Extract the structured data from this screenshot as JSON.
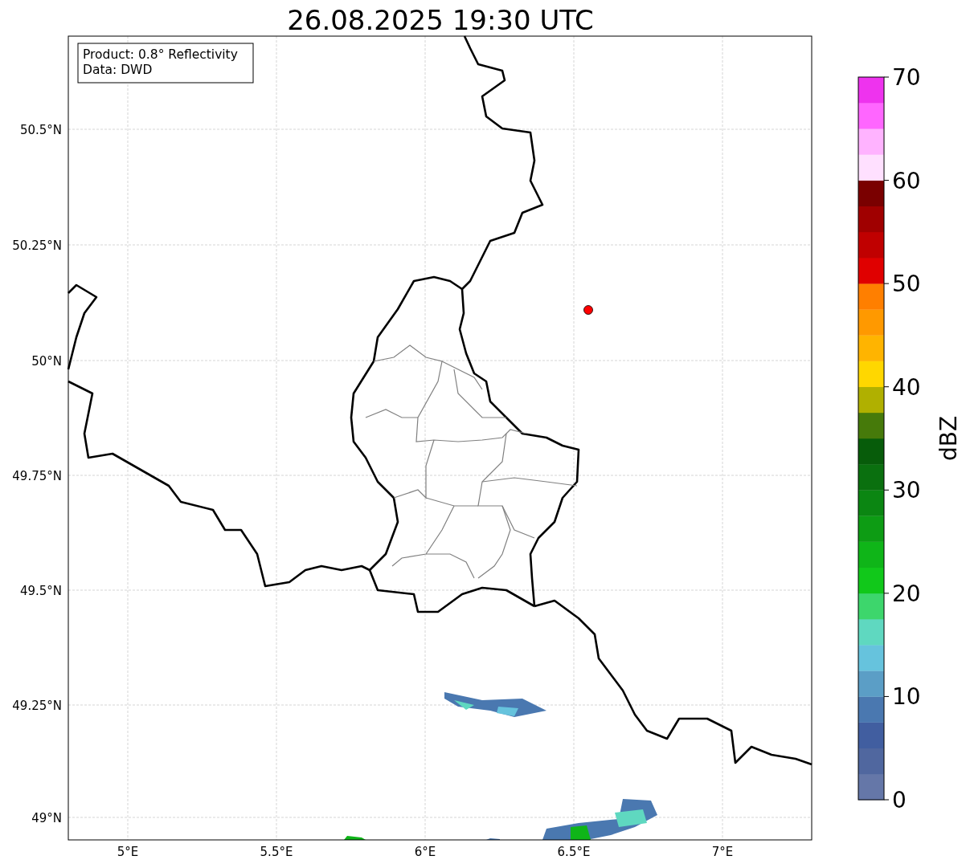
{
  "title": "26.08.2025 19:30 UTC",
  "info_box": [
    "Product: 0.8° Reflectivity",
    "Data: DWD"
  ],
  "x_tick_labels": [
    "5°E",
    "5.5°E",
    "6°E",
    "6.5°E",
    "7°E"
  ],
  "y_tick_labels": [
    "50.5°N",
    "50.25°N",
    "50°N",
    "49.75°N",
    "49.5°N",
    "49.25°N",
    "49°N"
  ],
  "colorbar": {
    "label": "dBZ",
    "tick_labels": [
      "70",
      "60",
      "50",
      "40",
      "30",
      "20",
      "10",
      "0"
    ],
    "segments": [
      {
        "color": "#6577a8"
      },
      {
        "color": "#50679f"
      },
      {
        "color": "#415ea0"
      },
      {
        "color": "#4a78b0"
      },
      {
        "color": "#5b9ec6"
      },
      {
        "color": "#66c3dd"
      },
      {
        "color": "#5fd8c0"
      },
      {
        "color": "#3dd66c"
      },
      {
        "color": "#11c81a"
      },
      {
        "color": "#0fb518"
      },
      {
        "color": "#0d9c14"
      },
      {
        "color": "#0b8612"
      },
      {
        "color": "#0a700f"
      },
      {
        "color": "#075c0a"
      },
      {
        "color": "#467a0a"
      },
      {
        "color": "#b0b000"
      },
      {
        "color": "#ffd700"
      },
      {
        "color": "#ffb400"
      },
      {
        "color": "#ff9900"
      },
      {
        "color": "#ff7f00"
      },
      {
        "color": "#e00000"
      },
      {
        "color": "#c00000"
      },
      {
        "color": "#a00000"
      },
      {
        "color": "#7a0000"
      },
      {
        "color": "#ffe0ff"
      },
      {
        "color": "#ffb3ff"
      },
      {
        "color": "#ff66ff"
      },
      {
        "color": "#ee33ee"
      }
    ]
  }
}
